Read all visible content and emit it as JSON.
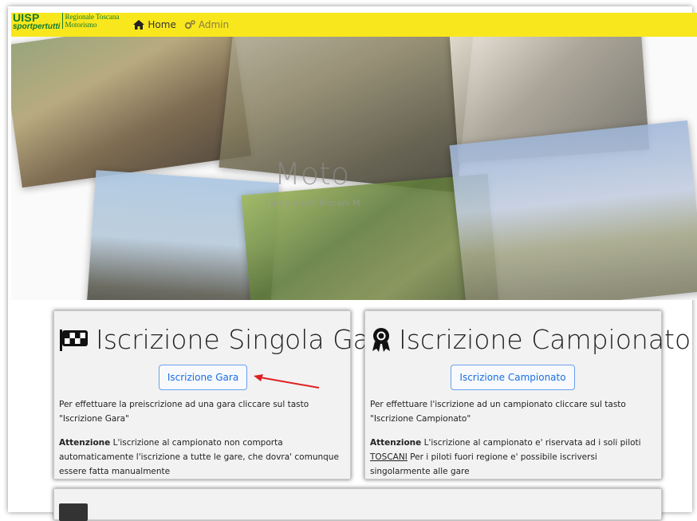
{
  "navbar": {
    "logo_top": "UISP",
    "logo_bottom": "sportpertutti",
    "logo_line1": "Regionale Toscana",
    "logo_line2": "Motorismo",
    "home_label": "Home",
    "admin_label": "Admin",
    "home_icon": "home-icon",
    "admin_icon": "cogs-icon",
    "bg_color": "#f9e71e"
  },
  "hero": {
    "title": "Moto",
    "subtitle": "Campionati Toscani M"
  },
  "cards": {
    "gara": {
      "title": "Iscrizione Singola Gara",
      "icon": "checkered-flag-icon",
      "button_label": "Iscrizione Gara",
      "text1": "Per effettuare la preiscrizione ad una gara cliccare sul tasto \"Iscrizione Gara\"",
      "attention_label": "Attenzione",
      "text2": " L'iscrizione al campionato non comporta automaticamente l'iscrizione a tutte le gare, che dovra' comunque essere fatta manualmente"
    },
    "campionato": {
      "title": "Iscrizione Campionato",
      "icon": "award-icon",
      "button_label": "Iscrizione Campionato",
      "text1": "Per effettuare l'iscrizione ad un campionato cliccare sul tasto \"Iscrizione Campionato\"",
      "attention_label": "Attenzione",
      "text2a": " L'iscrizione al campionato e' riservata ad i soli piloti ",
      "text2_link": "TOSCANI",
      "text2b": " Per i piloti fuori regione e' possibile iscriversi singolarmente alle gare"
    }
  },
  "colors": {
    "button_text": "#1b6fe3",
    "button_border": "#6aa0f0",
    "annotation_arrow": "#e02020"
  }
}
